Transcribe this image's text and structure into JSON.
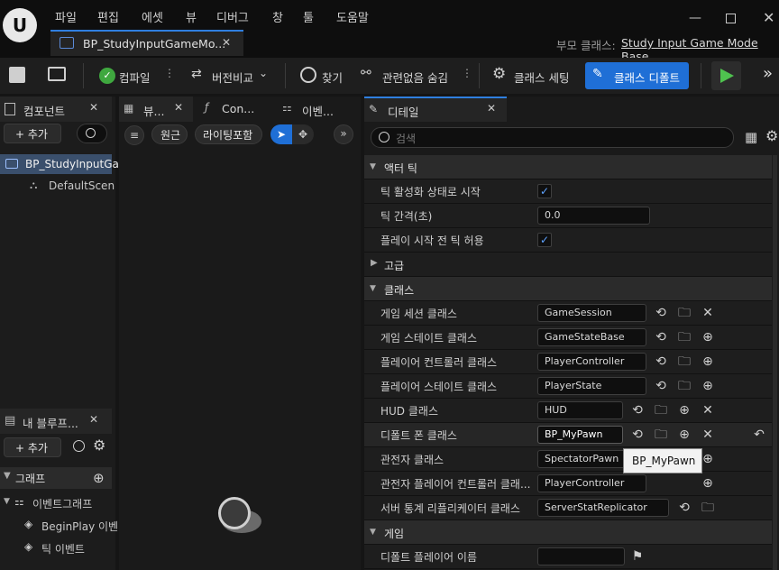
{
  "menu": [
    "파일",
    "편집",
    "에셋",
    "뷰",
    "디버그",
    "창",
    "툴",
    "도움말"
  ],
  "tab": {
    "title": "BP_StudyInputGameMo...",
    "parent_label": "부모 클래스:",
    "parent_value": "Study Input Game Mode Base"
  },
  "toolbar": {
    "compile": "컴파일",
    "diff": "버전비교",
    "find": "찾기",
    "hide_unrelated": "관련없음 숨김",
    "class_settings": "클래스 세팅",
    "class_defaults": "클래스 디폴트"
  },
  "components": {
    "title": "컴포넌트",
    "add": "+ 추가",
    "items": [
      "BP_StudyInputGa",
      "DefaultScen"
    ]
  },
  "viewport_tabs": [
    "뷰...",
    "Con...",
    "이벤..."
  ],
  "viewport": {
    "perspective": "원근",
    "lit": "라이팅포함"
  },
  "myblueprint": {
    "title": "내 블루프...",
    "add": "+ 추가",
    "graphs": "그래프",
    "event_graph": "이벤트그래프",
    "begin_play": "BeginPlay 이벤",
    "tick_event": "틱 이벤트"
  },
  "details": {
    "title": "디테일",
    "search_placeholder": "검색",
    "sections": {
      "actor_tick": "액터 틱",
      "advanced": "고급",
      "classes": "클래스",
      "game": "게임"
    },
    "tick_start": "틱 활성화 상태로 시작",
    "tick_interval": "틱 간격(초)",
    "tick_interval_value": "0.0",
    "tick_before_play": "플레이 시작 전 틱 허용",
    "game_session": "게임 세션 클래스",
    "game_session_v": "GameSession",
    "game_state": "게임 스테이트 클래스",
    "game_state_v": "GameStateBase",
    "player_controller": "플레이어 컨트롤러 클래스",
    "player_controller_v": "PlayerController",
    "player_state": "플레이어 스테이트 클래스",
    "player_state_v": "PlayerState",
    "hud": "HUD 클래스",
    "hud_v": "HUD",
    "default_pawn": "디폴트 폰 클래스",
    "default_pawn_v": "BP_MyPawn",
    "spectator": "관전자 클래스",
    "spectator_v": "SpectatorPawn",
    "spectator_pc": "관전자 플레이어 컨트롤러 클래...",
    "spectator_pc_v": "PlayerController",
    "server_stat": "서버 통계 리플리케이터 클래스",
    "server_stat_v": "ServerStatReplicator",
    "default_player_name": "디폴트 플레이어 이름",
    "tooltip": "BP_MyPawn"
  }
}
